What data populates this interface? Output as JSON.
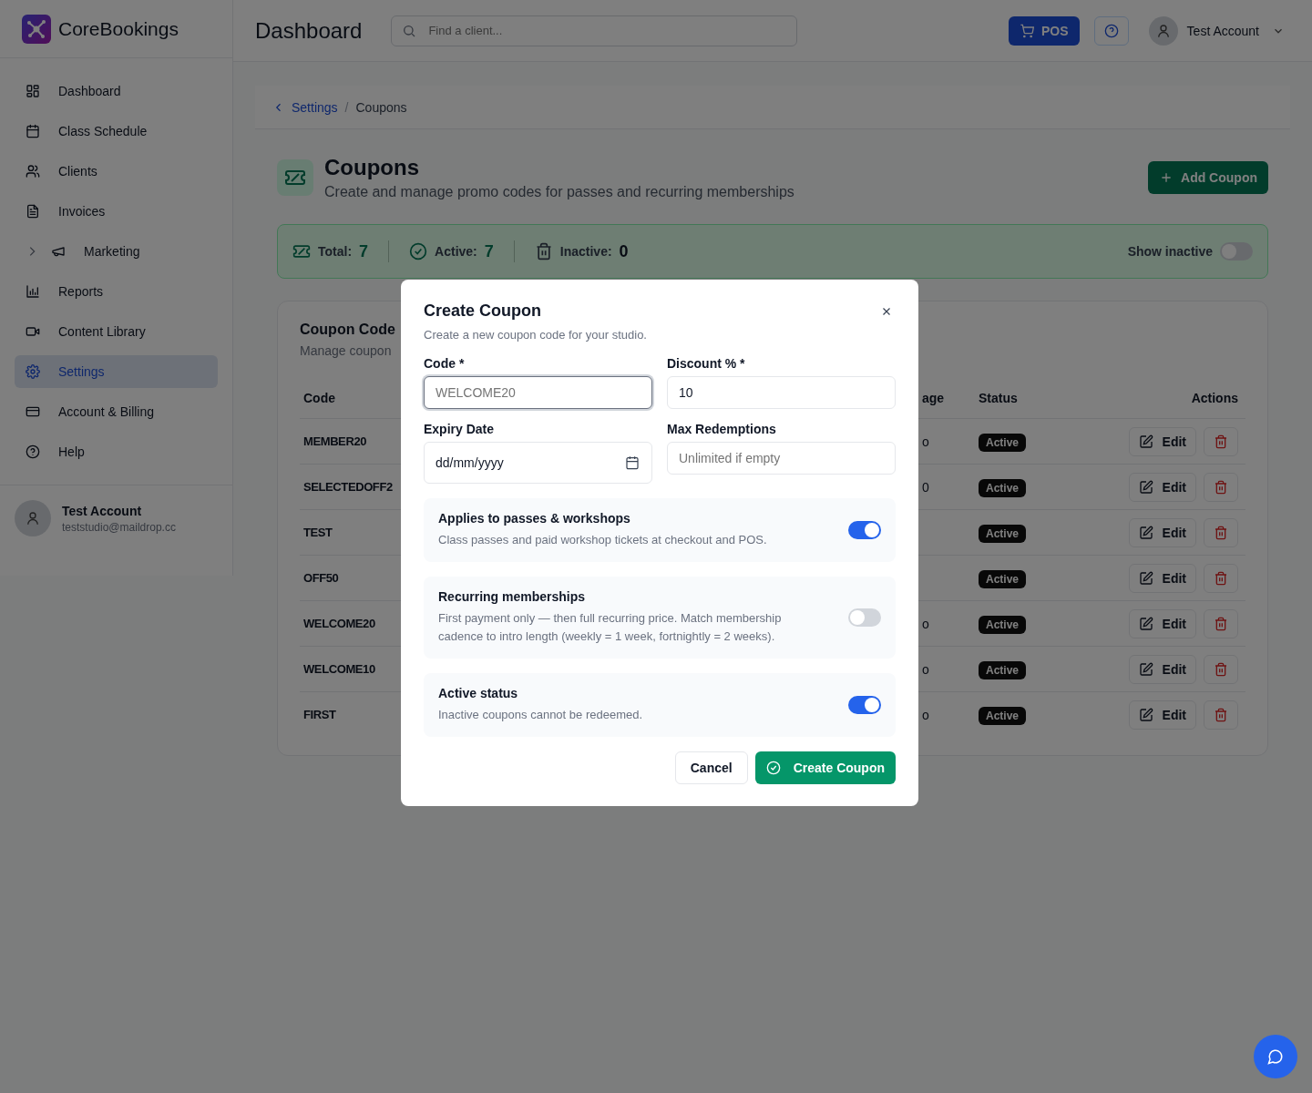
{
  "brand": {
    "name": "CoreBookings"
  },
  "header": {
    "title": "Dashboard",
    "search": {
      "placeholder": "Find a client..."
    },
    "pos_button": "POS",
    "account": "Test Account"
  },
  "sidebar": {
    "items": [
      {
        "label": "Dashboard",
        "kind": "link",
        "selected": false
      },
      {
        "label": "Class Schedule",
        "kind": "link",
        "selected": false
      },
      {
        "label": "Clients",
        "kind": "link",
        "selected": false
      },
      {
        "label": "Invoices",
        "kind": "link",
        "selected": false
      },
      {
        "label": "Marketing",
        "kind": "group",
        "selected": false
      },
      {
        "label": "Reports",
        "kind": "link",
        "selected": false
      },
      {
        "label": "Content Library",
        "kind": "link",
        "selected": false
      },
      {
        "label": "Settings",
        "kind": "link",
        "selected": true
      },
      {
        "label": "Account & Billing",
        "kind": "link",
        "selected": false
      },
      {
        "label": "Help",
        "kind": "link",
        "selected": false
      }
    ],
    "user": {
      "name": "Test Account",
      "email": "teststudio@maildrop.cc"
    }
  },
  "breadcrumb": {
    "parent": "Settings",
    "separator": "/",
    "current": "Coupons"
  },
  "page": {
    "title": "Coupons",
    "subtitle": "Create and manage promo codes for passes and recurring memberships",
    "add_button": "Add Coupon"
  },
  "stats": {
    "total_label": "Total:",
    "total": "7",
    "active_label": "Active:",
    "active": "7",
    "inactive_label": "Inactive:",
    "inactive": "0",
    "show_inactive_label": "Show inactive",
    "show_inactive": false
  },
  "table": {
    "title": "Coupon Code",
    "subtitle": "Manage coupon",
    "columns": {
      "code": "Code",
      "column_3": "age",
      "status": "Status",
      "actions": "Actions"
    },
    "rows": [
      {
        "code": "MEMBER20",
        "column_3": "o",
        "status": "Active",
        "edit": "Edit"
      },
      {
        "code": "SELECTEDOFF2",
        "column_3": "0",
        "status": "Active",
        "edit": "Edit"
      },
      {
        "code": "TEST",
        "status": "Active",
        "edit": "Edit"
      },
      {
        "code": "OFF50",
        "status": "Active",
        "edit": "Edit"
      },
      {
        "code": "WELCOME20",
        "column_3": "o",
        "status": "Active",
        "edit": "Edit"
      },
      {
        "code": "WELCOME10",
        "column_3": "o",
        "status": "Active",
        "edit": "Edit"
      },
      {
        "code": "FIRST",
        "column_3": "o",
        "status": "Active",
        "edit": "Edit"
      }
    ]
  },
  "dialog": {
    "title": "Create Coupon",
    "description": "Create a new coupon code for your studio.",
    "code": {
      "label": "Code *",
      "placeholder": "WELCOME20"
    },
    "discount": {
      "label": "Discount % *",
      "value": "10"
    },
    "expiry": {
      "label": "Expiry Date",
      "placeholder": "dd/mm/yyyy"
    },
    "max": {
      "label": "Max Redemptions",
      "placeholder": "Unlimited if empty"
    },
    "options": [
      {
        "title": "Applies to passes & workshops",
        "description": "Class passes and paid workshop tickets at checkout and POS.",
        "on": true
      },
      {
        "title": "Recurring memberships",
        "description": "First payment only — then full recurring price. Match membership cadence to intro length (weekly = 1 week, fortnightly = 2 weeks).",
        "on": false
      },
      {
        "title": "Active status",
        "description": "Inactive coupons cannot be redeemed.",
        "on": true
      }
    ],
    "cancel": "Cancel",
    "submit": "Create Coupon"
  }
}
